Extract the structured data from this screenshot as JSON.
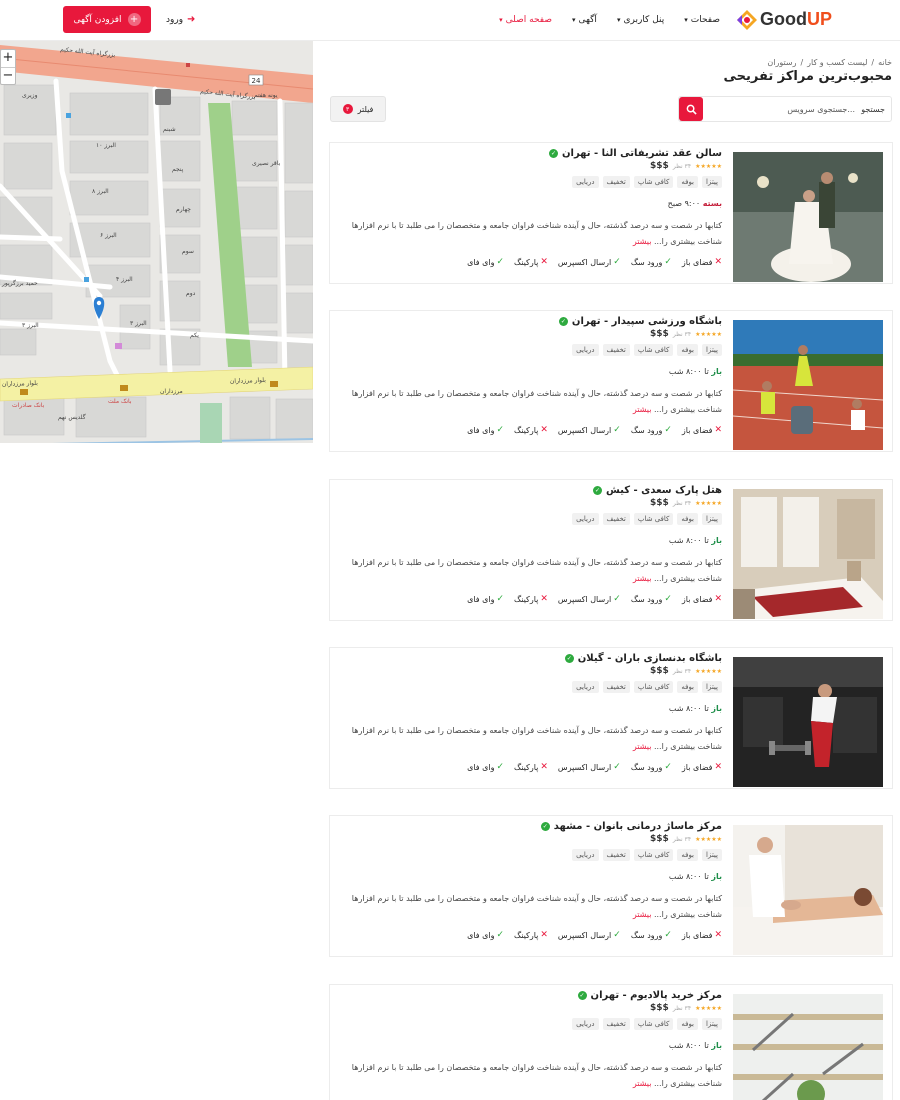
{
  "header": {
    "logo_text_a": "Good",
    "logo_text_b": "UP",
    "nav": [
      {
        "label": "صفحه اصلی",
        "active": true
      },
      {
        "label": "آگهی",
        "active": false
      },
      {
        "label": "پنل کاربری",
        "active": false
      },
      {
        "label": "صفحات",
        "active": false
      }
    ],
    "login_label": "ورود",
    "add_label": "افزودن آگهی"
  },
  "breadcrumb": [
    "خانه",
    "لیست کسب و کار",
    "رستوران"
  ],
  "page_title": "محبوب‌ترین مراکز تفریحی",
  "search": {
    "label": "جستجو",
    "placeholder": "جستجوی سرویس..."
  },
  "filter": {
    "label": "فیلتر",
    "count": "۳"
  },
  "map": {
    "streets": [
      "بزرگراه آیت الله حکیم",
      "بلوار مرزداران",
      "البرز ۱۰",
      "البرز ۸",
      "البرز ۶",
      "البرز ۴",
      "البرز ۳",
      "یونه هفتم",
      "پنجم",
      "چهارم",
      "سوم",
      "دوم",
      "یکم",
      "شبنم",
      "وزیری",
      "حمید برزگرپور",
      "گلدیس نهم",
      "مرزداران",
      "بانک صادرات",
      "بانک ملت",
      "باقر نصیری"
    ],
    "route_number": "24"
  },
  "listings": [
    {
      "title": "سالن عقد تشریفاتی النا - تهران",
      "rating": "★★★★★",
      "reviews": "۳۴ نظر",
      "price": "$$$",
      "tags": [
        "پیتزا",
        "بوفه",
        "کافی شاپ",
        "تخفیف",
        "دریایی"
      ],
      "status_label": "بسته",
      "status_kind": "closed",
      "hours": "۹:۰۰ صبح",
      "desc": "کتابها در شصت و سه درصد گذشته، حال و آینده شناخت فراوان جامعه و متخصصان را می طلبد تا با نرم افزارها شناخت بیشتری را...",
      "more": "بیشتر",
      "features": [
        {
          "label": "فضای باز",
          "ok": false
        },
        {
          "label": "ورود سگ",
          "ok": true
        },
        {
          "label": "ارسال اکسپرس",
          "ok": true
        },
        {
          "label": "پارکینگ",
          "ok": false
        },
        {
          "label": "وای فای",
          "ok": true
        }
      ],
      "photo": "wedding"
    },
    {
      "title": "باشگاه ورزشی سپیدار - تهران",
      "rating": "★★★★★",
      "reviews": "۳۴ نظر",
      "price": "$$$",
      "tags": [
        "پیتزا",
        "بوفه",
        "کافی شاپ",
        "تخفیف",
        "دریایی"
      ],
      "status_label": "باز",
      "status_kind": "open",
      "hours": "تا ۸:۰۰ شب",
      "desc": "کتابها در شصت و سه درصد گذشته، حال و آینده شناخت فراوان جامعه و متخصصان را می طلبد تا با نرم افزارها شناخت بیشتری را...",
      "more": "بیشتر",
      "features": [
        {
          "label": "فضای باز",
          "ok": false
        },
        {
          "label": "ورود سگ",
          "ok": true
        },
        {
          "label": "ارسال اکسپرس",
          "ok": true
        },
        {
          "label": "پارکینگ",
          "ok": false
        },
        {
          "label": "وای فای",
          "ok": true
        }
      ],
      "photo": "track"
    },
    {
      "title": "هتل پارک سعدی - کیش",
      "rating": "★★★★★",
      "reviews": "۳۴ نظر",
      "price": "$$$",
      "tags": [
        "پیتزا",
        "بوفه",
        "کافی شاپ",
        "تخفیف",
        "دریایی"
      ],
      "status_label": "باز",
      "status_kind": "open",
      "hours": "تا ۸:۰۰ شب",
      "desc": "کتابها در شصت و سه درصد گذشته، حال و آینده شناخت فراوان جامعه و متخصصان را می طلبد تا با نرم افزارها شناخت بیشتری را...",
      "more": "بیشتر",
      "features": [
        {
          "label": "فضای باز",
          "ok": false
        },
        {
          "label": "ورود سگ",
          "ok": true
        },
        {
          "label": "ارسال اکسپرس",
          "ok": true
        },
        {
          "label": "پارکینگ",
          "ok": false
        },
        {
          "label": "وای فای",
          "ok": true
        }
      ],
      "photo": "hotel"
    },
    {
      "title": "باشگاه بدنسازی باران - گیلان",
      "rating": "★★★★★",
      "reviews": "۳۴ نظر",
      "price": "$$$",
      "tags": [
        "پیتزا",
        "بوفه",
        "کافی شاپ",
        "تخفیف",
        "دریایی"
      ],
      "status_label": "باز",
      "status_kind": "open",
      "hours": "تا ۸:۰۰ شب",
      "desc": "کتابها در شصت و سه درصد گذشته، حال و آینده شناخت فراوان جامعه و متخصصان را می طلبد تا با نرم افزارها شناخت بیشتری را...",
      "more": "بیشتر",
      "features": [
        {
          "label": "فضای باز",
          "ok": false
        },
        {
          "label": "ورود سگ",
          "ok": true
        },
        {
          "label": "ارسال اکسپرس",
          "ok": true
        },
        {
          "label": "پارکینگ",
          "ok": false
        },
        {
          "label": "وای فای",
          "ok": true
        }
      ],
      "photo": "gym"
    },
    {
      "title": "مرکز ماساژ درمانی بانوان - مشهد",
      "rating": "★★★★★",
      "reviews": "۳۴ نظر",
      "price": "$$$",
      "tags": [
        "پیتزا",
        "بوفه",
        "کافی شاپ",
        "تخفیف",
        "دریایی"
      ],
      "status_label": "باز",
      "status_kind": "open",
      "hours": "تا ۸:۰۰ شب",
      "desc": "کتابها در شصت و سه درصد گذشته، حال و آینده شناخت فراوان جامعه و متخصصان را می طلبد تا با نرم افزارها شناخت بیشتری را...",
      "more": "بیشتر",
      "features": [
        {
          "label": "فضای باز",
          "ok": false
        },
        {
          "label": "ورود سگ",
          "ok": true
        },
        {
          "label": "ارسال اکسپرس",
          "ok": true
        },
        {
          "label": "پارکینگ",
          "ok": false
        },
        {
          "label": "وای فای",
          "ok": true
        }
      ],
      "photo": "massage"
    },
    {
      "title": "مرکز خرید پالادیوم - تهران",
      "rating": "★★★★★",
      "reviews": "۳۴ نظر",
      "price": "$$$",
      "tags": [
        "پیتزا",
        "بوفه",
        "کافی شاپ",
        "تخفیف",
        "دریایی"
      ],
      "status_label": "باز",
      "status_kind": "open",
      "hours": "تا ۸:۰۰ شب",
      "desc": "کتابها در شصت و سه درصد گذشته، حال و آینده شناخت فراوان جامعه و متخصصان را می طلبد تا با نرم افزارها شناخت بیشتری را...",
      "more": "بیشتر",
      "features": [],
      "photo": "mall"
    }
  ],
  "colors": {
    "accent": "#e8183c",
    "open": "#1f8f4a",
    "closed": "#c41e3a",
    "star": "#f5a623",
    "verified": "#2eaa3f"
  }
}
